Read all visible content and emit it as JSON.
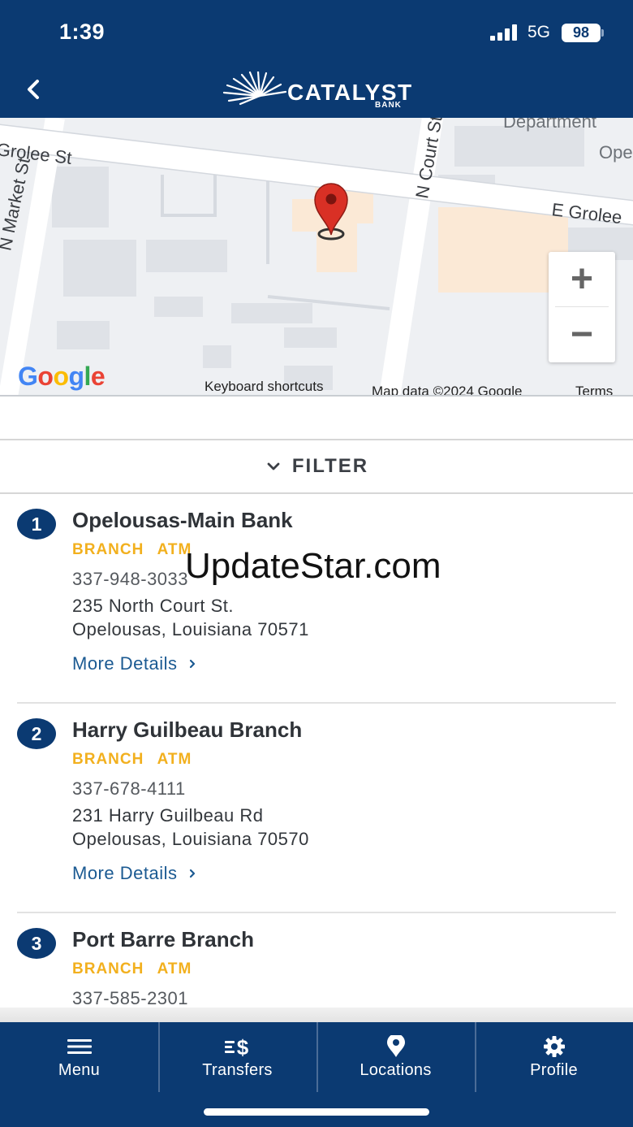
{
  "status_bar": {
    "time": "1:39",
    "network": "5G",
    "battery": "98"
  },
  "header": {
    "logo_text": "CATALYST",
    "logo_sub": "BANK"
  },
  "map": {
    "street_labels": [
      "Grolee St",
      "N Market St",
      "N Court St",
      "E Grolee",
      "Department",
      "Ope"
    ],
    "google_logo": "Google",
    "keyboard_shortcuts": "Keyboard shortcuts",
    "map_data": "Map data ©2024 Google",
    "terms": "Terms",
    "zoom_in": "+",
    "zoom_out": "−"
  },
  "filter": {
    "label": "FILTER"
  },
  "locations": [
    {
      "number": "1",
      "name": "Opelousas-Main Bank",
      "tags": [
        "BRANCH",
        "ATM"
      ],
      "phone": "337-948-3033",
      "address_line1": "235 North Court St.",
      "address_line2": "Opelousas, Louisiana 70571",
      "more_label": "More Details"
    },
    {
      "number": "2",
      "name": "Harry Guilbeau Branch",
      "tags": [
        "BRANCH",
        "ATM"
      ],
      "phone": "337-678-4111",
      "address_line1": "231 Harry Guilbeau Rd",
      "address_line2": "Opelousas, Louisiana 70570",
      "more_label": "More Details"
    },
    {
      "number": "3",
      "name": "Port Barre Branch",
      "tags": [
        "BRANCH",
        "ATM"
      ],
      "phone": "337-585-2301",
      "address_line1": "",
      "address_line2": "",
      "more_label": ""
    }
  ],
  "watermark": "UpdateStar.com",
  "bottom_nav": [
    {
      "label": "Menu",
      "icon": "menu-icon"
    },
    {
      "label": "Transfers",
      "icon": "transfers-icon"
    },
    {
      "label": "Locations",
      "icon": "location-pin-icon"
    },
    {
      "label": "Profile",
      "icon": "gear-icon"
    }
  ],
  "colors": {
    "brand_navy": "#0b3a72",
    "tag_gold": "#f2b01e",
    "link_blue": "#1b5a92",
    "pin_red": "#d93025"
  }
}
